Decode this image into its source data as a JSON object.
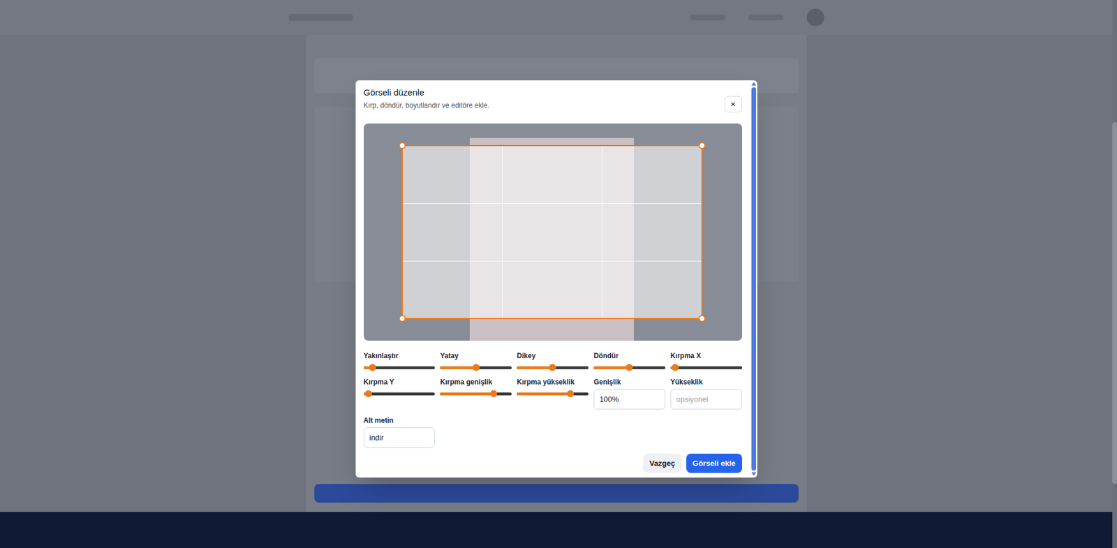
{
  "dialog": {
    "title": "Görseli düzenle",
    "subtitle": "Kırp, döndür, boyutlandır ve editöre ekle.",
    "close": "×"
  },
  "sliders": [
    {
      "label": "Yakınlaştır",
      "level": 0.13
    },
    {
      "label": "Yatay",
      "level": 0.5
    },
    {
      "label": "Dikey",
      "level": 0.5
    },
    {
      "label": "Döndür",
      "level": 0.5
    },
    {
      "label": "Kırpma X",
      "level": 0.07
    },
    {
      "label": "Kırpma Y",
      "level": 0.07
    },
    {
      "label": "Kırpma genişlik",
      "level": 0.75
    },
    {
      "label": "Kırpma yükseklik",
      "level": 0.75
    }
  ],
  "fields": [
    {
      "label": "Genişlik",
      "value": "100%",
      "placeholder": ""
    },
    {
      "label": "Yükseklik",
      "value": "",
      "placeholder": "opsiyonel"
    }
  ],
  "alt_field": {
    "label": "Alt metin",
    "value": "indir",
    "placeholder": ""
  },
  "buttons": [
    {
      "label": "Vazgeç",
      "primary": false
    },
    {
      "label": "Görseli ekle",
      "primary": true
    }
  ]
}
